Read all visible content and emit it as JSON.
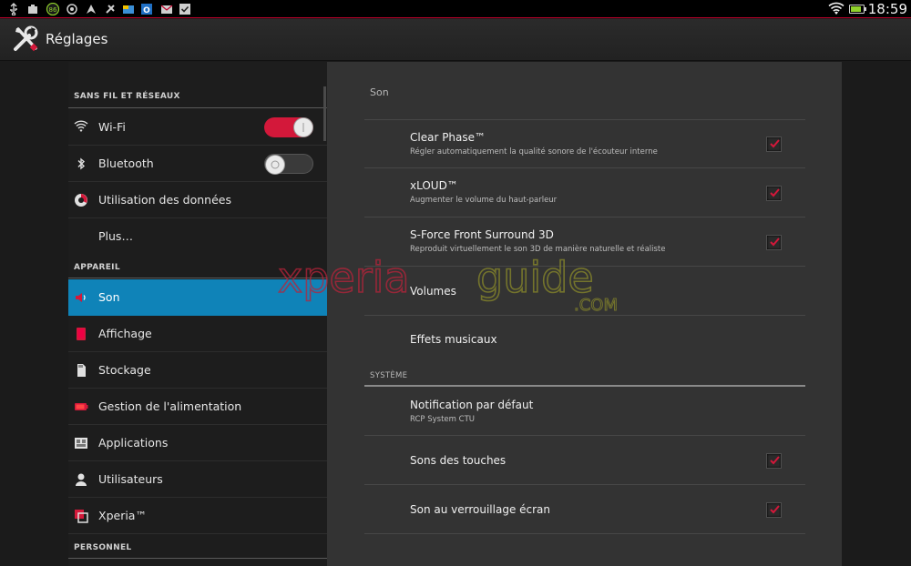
{
  "status_bar": {
    "time": "18:59",
    "notification_icons": [
      "usb-icon",
      "download-icon",
      "badge-86-icon",
      "sync-icon",
      "gps-icon",
      "usb-debug-icon",
      "store-icon",
      "outlook-icon",
      "email-icon",
      "tasks-icon"
    ],
    "badge_text": "86"
  },
  "action_bar": {
    "title": "Réglages",
    "icon": "settings-tools-icon"
  },
  "sidebar": {
    "sections": [
      {
        "header": "SANS FIL ET RÉSEAUX"
      },
      {
        "header": "APPAREIL"
      },
      {
        "header": "PERSONNEL"
      }
    ],
    "items": [
      {
        "label": "Wi-Fi",
        "icon": "wifi-icon",
        "toggle": "on"
      },
      {
        "label": "Bluetooth",
        "icon": "bluetooth-icon",
        "toggle": "off"
      },
      {
        "label": "Utilisation des données",
        "icon": "data-usage-icon"
      },
      {
        "label": "Plus…",
        "icon": ""
      },
      {
        "label": "Son",
        "icon": "speaker-icon",
        "active": true
      },
      {
        "label": "Affichage",
        "icon": "display-icon"
      },
      {
        "label": "Stockage",
        "icon": "storage-icon"
      },
      {
        "label": "Gestion de l'alimentation",
        "icon": "battery-icon"
      },
      {
        "label": "Applications",
        "icon": "applications-icon"
      },
      {
        "label": "Utilisateurs",
        "icon": "users-icon"
      },
      {
        "label": "Xperia™",
        "icon": "xperia-icon"
      }
    ]
  },
  "main": {
    "category": "Son",
    "system_header": "SYSTÈME",
    "prefs": [
      {
        "title": "Clear Phase™",
        "summary": "Régler automatiquement la qualité sonore de l'écouteur interne",
        "checked": true
      },
      {
        "title": "xLOUD™",
        "summary": "Augmenter le volume du haut-parleur",
        "checked": true
      },
      {
        "title": "S-Force Front Surround 3D",
        "summary": "Reproduit virtuellement le son 3D de manière naturelle et réaliste",
        "checked": true
      },
      {
        "title": "Volumes"
      },
      {
        "title": "Effets musicaux"
      },
      {
        "title": "Notification par défaut",
        "summary": "RCP System CTU"
      },
      {
        "title": "Sons des touches",
        "checked": true
      },
      {
        "title": "Son au verrouillage écran",
        "checked": true
      }
    ]
  },
  "watermark": {
    "text_left": "xperia",
    "text_right": "guide",
    "suffix": ".COM"
  },
  "colors": {
    "accent_blue": "#0f83b8",
    "toggle_red": "#d3183a",
    "check_red": "#d3183a"
  }
}
